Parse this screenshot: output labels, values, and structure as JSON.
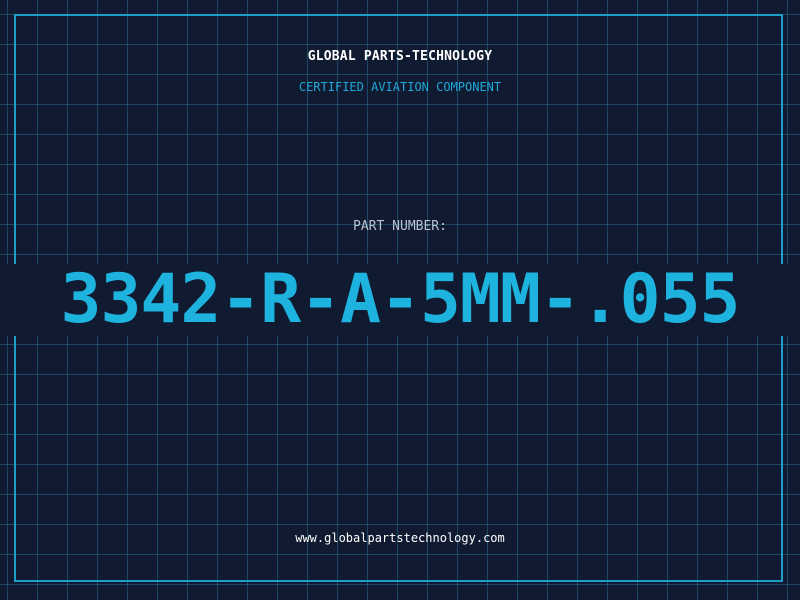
{
  "header": {
    "brand": "GLOBAL PARTS-TECHNOLOGY",
    "tagline": "CERTIFIED AVIATION COMPONENT"
  },
  "part": {
    "label": "PART NUMBER:",
    "number": "3342-R-A-5MM-.055"
  },
  "footer": {
    "website": "www.globalpartstechnology.com"
  },
  "colors": {
    "background": "#101a30",
    "grid": "#286e8c",
    "frame": "#1e9fc7",
    "accent": "#1eb2de",
    "tagline": "#1fa8d8",
    "label": "#b9c3d2",
    "text": "#ffffff"
  }
}
